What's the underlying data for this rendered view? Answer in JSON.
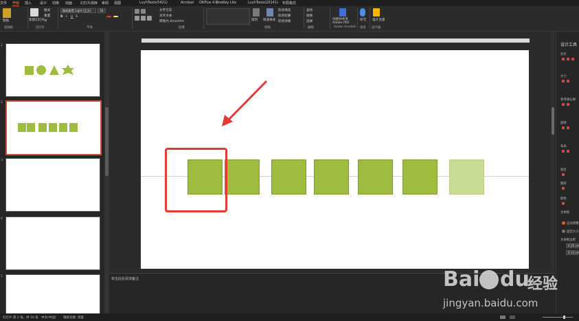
{
  "tabs": [
    "文件",
    "开始",
    "插入",
    "设计",
    "切换",
    "动画",
    "幻灯片放映",
    "审阅",
    "视图",
    "LvyhTools(5421)",
    "Acrobat",
    "OKPlus 4.5",
    "OneKey Lite",
    "LvyhTools(20141)",
    "布局格式"
  ],
  "active_tab_index": 1,
  "ribbon": {
    "font_name": "微软雅黑 Light (正文)",
    "font_size": "18",
    "group_labels": [
      "剪贴板",
      "幻灯片",
      "字体",
      "段落",
      "绘图",
      "编辑",
      "Adobe Acrobat",
      "语音",
      "设计器"
    ],
    "buttons": {
      "paste": "粘贴",
      "new_slide": "新建幻灯片",
      "reset": "重置",
      "section": "节",
      "layout": "版式",
      "text_direction": "文字方向",
      "align_text": "对齐文本",
      "convert_smartart": "转换为 SmartArt",
      "arrange": "排列",
      "quick_styles": "快速样式",
      "shape_fill": "形状填充",
      "shape_outline": "形状轮廓",
      "shape_effects": "形状效果",
      "find": "查找",
      "replace": "替换",
      "select": "选择",
      "create_pdf": "创建并共享 Adobe PDF",
      "dictate": "听写",
      "design_ideas": "设计灵感"
    }
  },
  "slides": [
    {
      "number": "1"
    },
    {
      "number": "2"
    },
    {
      "number": "3"
    },
    {
      "number": "4"
    },
    {
      "number": "5"
    }
  ],
  "notes_placeholder": "单击此处添加备注",
  "right_panel": {
    "title": "设计工具",
    "labels": [
      "对齐",
      "大小",
      "参考线与网",
      "旋转",
      "布局",
      "组合",
      "图形",
      "颜色",
      "文本框",
      "自动调整",
      "固定大小",
      "文本框边距"
    ],
    "margin_values": [
      "0.25 cm",
      "0.13 cm"
    ]
  },
  "status": {
    "slide_info": "幻灯片 第 2 张，共 16 张",
    "language": "中文(中国)",
    "accessibility": "辅助功能: 调查"
  },
  "watermark": {
    "brand": "Bai",
    "brand2": "du",
    "cn": "经验",
    "url": "jingyan.baidu.com"
  },
  "colors": {
    "accent": "#e05a2b",
    "square_green": "#9ebd3f",
    "square_light": "#c8dc96",
    "highlight_red": "#e53935"
  }
}
